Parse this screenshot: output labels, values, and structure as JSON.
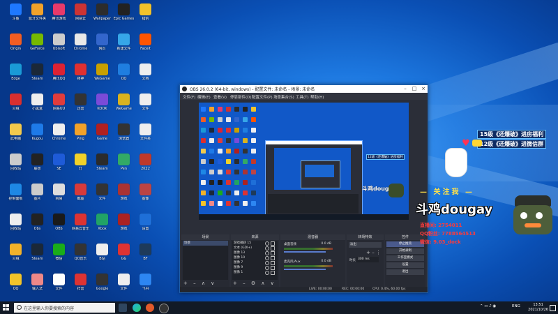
{
  "desktop": {
    "icons": [
      {
        "label": "斗鱼",
        "color": "#1e78ff"
      },
      {
        "label": "蓝牙文件夹",
        "color": "#f2a22a"
      },
      {
        "label": "腾讯游戏",
        "color": "#e83a6a"
      },
      {
        "label": "网易云",
        "color": "#cc3333"
      },
      {
        "label": "Wallpaper",
        "color": "#2c2c2c"
      },
      {
        "label": "Epic Games",
        "color": "#222"
      },
      {
        "label": "猎豹",
        "color": "#f2c22a"
      },
      {
        "label": "Origin",
        "color": "#f25d22"
      },
      {
        "label": "GeForce",
        "color": "#76b900"
      },
      {
        "label": "Ubisoft",
        "color": "#ccc"
      },
      {
        "label": "Chrome",
        "color": "#e8e8e8"
      },
      {
        "label": "网页",
        "color": "#3366cc"
      },
      {
        "label": "新建文件",
        "color": "#36a6e8"
      },
      {
        "label": "Faceit",
        "color": "#ff5500"
      },
      {
        "label": "Edge",
        "color": "#1a9ad6"
      },
      {
        "label": "Steam",
        "color": "#1b2838"
      },
      {
        "label": "腾讯QQ",
        "color": "#d23"
      },
      {
        "label": "夜神",
        "color": "#e03030"
      },
      {
        "label": "WeGame",
        "color": "#c8a000"
      },
      {
        "label": "QQ",
        "color": "#1f7ee0"
      },
      {
        "label": "文档",
        "color": "#eee"
      },
      {
        "label": "火绒",
        "color": "#d92f2f"
      },
      {
        "label": "小黑盒",
        "color": "#eeeeee"
      },
      {
        "label": "网易UU",
        "color": "#e03c3c"
      },
      {
        "label": "迅雷",
        "color": "#333"
      },
      {
        "label": "KOOK",
        "color": "#7a4bd8"
      },
      {
        "label": "WeGame",
        "color": "#d8b21f"
      },
      {
        "label": "文件",
        "color": "#eee"
      },
      {
        "label": "此电脑",
        "color": "#f2c94c"
      },
      {
        "label": "Kugou",
        "color": "#1e7ae8"
      },
      {
        "label": "Chrome",
        "color": "#eee"
      },
      {
        "label": "Ping",
        "color": "#f2a22a"
      },
      {
        "label": "Game",
        "color": "#b02020"
      },
      {
        "label": "浏览器",
        "color": "#333"
      },
      {
        "label": "文件夹",
        "color": "#eee"
      },
      {
        "label": "回收站",
        "color": "#ccc"
      },
      {
        "label": "联想",
        "color": "#222"
      },
      {
        "label": "SE",
        "color": "#1e5bd8"
      },
      {
        "label": "灯",
        "color": "#f2d22a"
      },
      {
        "label": "Steam",
        "color": "#2b2b2b"
      },
      {
        "label": "Pen",
        "color": "#3a6"
      },
      {
        "label": "2K22",
        "color": "#c0392b"
      },
      {
        "label": "控制面板",
        "color": "#1e88e5"
      },
      {
        "label": "图片",
        "color": "#ccc"
      },
      {
        "label": "网易",
        "color": "#ddd"
      },
      {
        "label": "截图",
        "color": "#d83a3a"
      },
      {
        "label": "文件",
        "color": "#333"
      },
      {
        "label": "游戏",
        "color": "#a33"
      },
      {
        "label": "图像",
        "color": "#b44"
      },
      {
        "label": "回收站",
        "color": "#eee"
      },
      {
        "label": "Obs",
        "color": "#222"
      },
      {
        "label": "OBS",
        "color": "#1a1a1a"
      },
      {
        "label": "网易云音乐",
        "color": "#d33"
      },
      {
        "label": "Xbox",
        "color": "#21a366"
      },
      {
        "label": "游戏",
        "color": "#a22"
      },
      {
        "label": "设置",
        "color": "#1e6fd8"
      },
      {
        "label": "火绒",
        "color": "#f2b22a"
      },
      {
        "label": "Steam",
        "color": "#1b2838"
      },
      {
        "label": "微信",
        "color": "#1aad19"
      },
      {
        "label": "QQ音乐",
        "color": "#333"
      },
      {
        "label": "B站",
        "color": "#eee"
      },
      {
        "label": "GG",
        "color": "#d33"
      },
      {
        "label": "BF",
        "color": "#1e3a5a"
      },
      {
        "label": "QQ",
        "color": "#f2c42a"
      },
      {
        "label": "输入法",
        "color": "#e88"
      },
      {
        "label": "文件",
        "color": "#fff"
      },
      {
        "label": "扫雷",
        "color": "#d33"
      },
      {
        "label": "Google",
        "color": "#333"
      },
      {
        "label": "文件",
        "color": "#eee"
      },
      {
        "label": "飞书",
        "color": "#2d86f2"
      }
    ]
  },
  "obs": {
    "title": "OBS 26.0.2 (64-bit, windows) - 配置文件: 未命名 - 场景: 未命名",
    "menu": [
      "文件(F)",
      "编辑(E)",
      "查看(V)",
      "停靠部件(D)",
      "配置文件(P)",
      "场景集合(S)",
      "工具(T)",
      "帮助(H)"
    ],
    "docks": {
      "scenes": {
        "header": "场景",
        "items": [
          "场景"
        ]
      },
      "sources": {
        "header": "来源",
        "items": [
          "游戏捕获 15",
          "文本 (GDI+)",
          "图像 13",
          "图像 10",
          "图像 7",
          "图像 9",
          "图像 1"
        ]
      },
      "mixer": {
        "header": "混音器",
        "rows": [
          {
            "name": "桌面音频",
            "db": "0.0 dB"
          },
          {
            "name": "麦克风/Aux",
            "db": "0.0 dB"
          }
        ]
      },
      "transitions": {
        "header": "转场特效",
        "type": "淡出",
        "duration_label": "时长",
        "duration": "300 ms"
      },
      "controls": {
        "header": "控件",
        "buttons": [
          "停止推流",
          "开始录制",
          "工作室模式",
          "设置",
          "退出"
        ]
      }
    },
    "status": {
      "live": "LIVE: 00:00:00",
      "rec": "REC: 00:00:00",
      "cpu": "CPU: 0.4%, 60.00 fps"
    }
  },
  "overlay": {
    "banner1": "15级《还爆破》进房福利",
    "banner2": "12级《还爆破》进微信群",
    "mini_banner": "12级《还爆破》进房福利",
    "follow": "— 关注我 —",
    "streamer": "斗鸡dougay",
    "info": [
      "直播间: 2754011",
      "QQ粉丝: 7788564513",
      "微信: 9.03_dock"
    ],
    "preview_name": "斗鸡dougay"
  },
  "taskbar": {
    "search_placeholder": "在这里输入你要搜索的内容",
    "tray_lang": "ENG",
    "time": "13:51",
    "date": "2021/10/26"
  }
}
